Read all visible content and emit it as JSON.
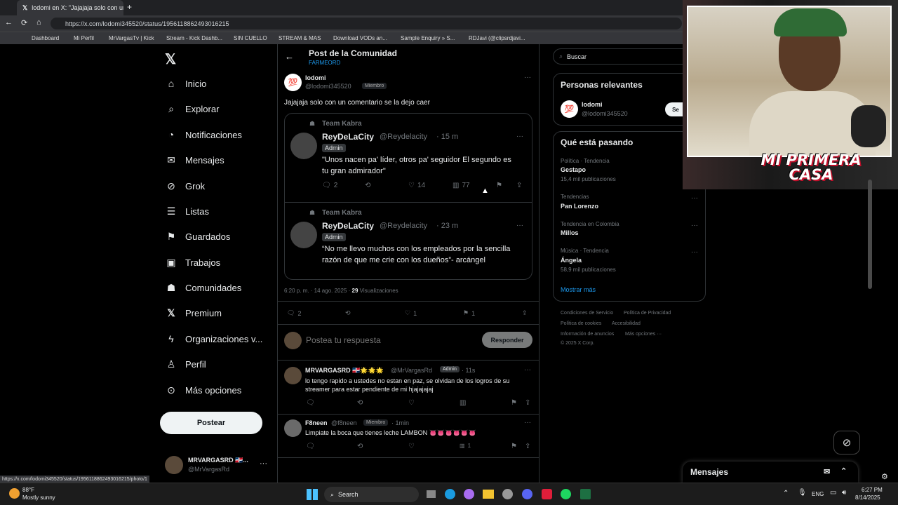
{
  "browser": {
    "tab_title": "lodomi en X: \"Jajajaja solo con un",
    "url": "https://x.com/lodomi345520/status/1956118862493016215",
    "bookmarks": [
      "Dashboard",
      "Mi Perfil",
      "MrVargasTv | Kick",
      "Stream - Kick Dashb...",
      "SIN CUELLO",
      "STREAM & MAS",
      "Download VODs an...",
      "Sample Enquiry » S...",
      "RDJavi (@clipsrdjavi..."
    ],
    "status_url": "https://x.com/lodomi345520/status/1956118862493016215/photo/1"
  },
  "sidebar": {
    "items": [
      {
        "label": "Inicio",
        "icon": "home-icon"
      },
      {
        "label": "Explorar",
        "icon": "search-icon"
      },
      {
        "label": "Notificaciones",
        "icon": "bell-icon"
      },
      {
        "label": "Mensajes",
        "icon": "mail-icon"
      },
      {
        "label": "Grok",
        "icon": "grok-icon"
      },
      {
        "label": "Listas",
        "icon": "list-icon"
      },
      {
        "label": "Guardados",
        "icon": "bookmark-icon"
      },
      {
        "label": "Trabajos",
        "icon": "briefcase-icon"
      },
      {
        "label": "Comunidades",
        "icon": "people-icon"
      },
      {
        "label": "Premium",
        "icon": "x-icon"
      },
      {
        "label": "Organizaciones v...",
        "icon": "lightning-icon"
      },
      {
        "label": "Perfil",
        "icon": "person-icon"
      },
      {
        "label": "Más opciones",
        "icon": "more-circle-icon"
      }
    ],
    "post_button": "Postear",
    "account_name": "MRVARGASRD 🇩🇴...",
    "account_handle": "@MrVargasRd"
  },
  "header": {
    "title": "Post de la Comunidad",
    "community": "FARMEORD"
  },
  "post": {
    "author": "lodomi",
    "handle": "@lodomi345520",
    "badge": "Miembro",
    "text": "Jajajaja solo con un comentario se la dejo caer",
    "quotes": [
      {
        "community": "Team Kabra",
        "name": "ReyDeLaCity",
        "handle": "@Reydelacity",
        "time": "15 m",
        "badge": "Admin",
        "text": "\"Unos nacen pa' líder, otros pa' seguidor El segundo es tu gran admirador\"",
        "replies": "2",
        "likes": "14",
        "views": "77"
      },
      {
        "community": "Team Kabra",
        "name": "ReyDeLaCity",
        "handle": "@Reydelacity",
        "time": "23 m",
        "badge": "Admin",
        "text": "“No me llevo muchos con los empleados por la sencilla razón de que me crie con los dueños”- arcángel"
      }
    ],
    "timestamp": "6:20 p. m. · 14 ago. 2025 ·",
    "views_count": "29",
    "views_label": "Visualizaciones",
    "stats": {
      "replies": "2",
      "likes": "1",
      "bookmarks": "1"
    }
  },
  "reply_box": {
    "placeholder": "Postea tu respuesta",
    "button": "Responder"
  },
  "replies": [
    {
      "name": "MRVARGASRD 🇩🇴🌟🌟🌟",
      "handle": "@MrVargasRd",
      "badge": "Admin",
      "time": "11s",
      "text": "lo tengo rapido a ustedes no estan en paz, se olvidan de los logros de su streamer para estar pendiente de mi hjajajajaj"
    },
    {
      "name": "F8neen",
      "handle": "@f8neen",
      "badge": "Miembro",
      "time": "1min",
      "text": "Limpiate la boca que tienes leche LAMBON 👅👅👅👅👅👅",
      "views": "1"
    }
  ],
  "right": {
    "search_placeholder": "Buscar",
    "relevant_title": "Personas relevantes",
    "relevant_name": "lodomi",
    "relevant_handle": "@lodomi345520",
    "relevant_button": "Se",
    "trending_title": "Qué está pasando",
    "trends": [
      {
        "context": "Política · Tendencia",
        "name": "Gestapo",
        "count": "15,4 mil publicaciones"
      },
      {
        "context": "Tendencias",
        "name": "Pan Lorenzo",
        "count": ""
      },
      {
        "context": "Tendencia en Colombia",
        "name": "Millos",
        "count": ""
      },
      {
        "context": "Música · Tendencia",
        "name": "Ángela",
        "count": "58,9 mil publicaciones"
      }
    ],
    "show_more": "Mostrar más",
    "footer": [
      "Condiciones de Servicio",
      "Política de Privacidad",
      "Política de cookies",
      "Accesibilidad",
      "Información de anuncios",
      "Más opciones ···",
      "© 2025 X Corp."
    ],
    "messages": "Mensajes"
  },
  "overlay": {
    "text": "MI PRIMERA CASA"
  },
  "taskbar": {
    "temp": "88°F",
    "weather": "Mostly sunny",
    "search": "Search",
    "lang": "ENG",
    "time": "6:27 PM",
    "date": "8/14/2025"
  }
}
